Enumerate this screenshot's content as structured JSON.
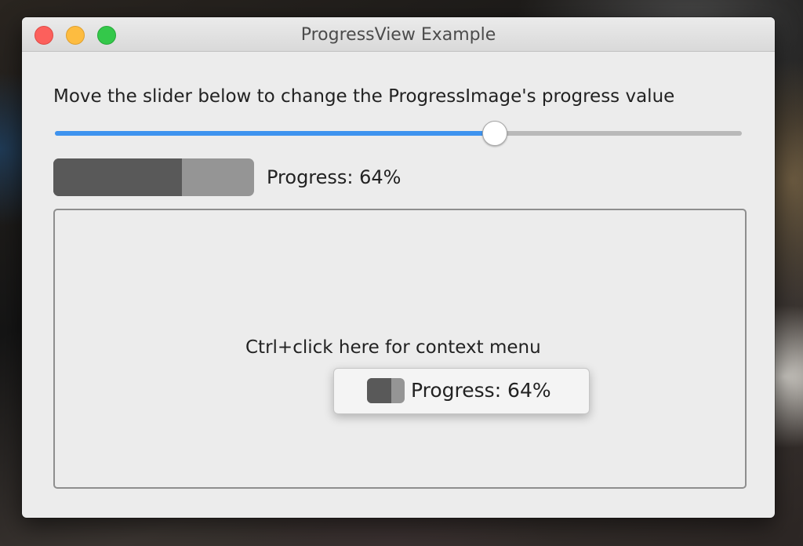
{
  "window": {
    "title": "ProgressView Example"
  },
  "main": {
    "instruction": "Move the slider below to change the ProgressImage's progress value",
    "slider": {
      "value": 0.64
    },
    "progress_image": {
      "value": 0.64
    },
    "progress_label": "Progress: 64%",
    "context_area": {
      "hint": "Ctrl+click here for context menu"
    }
  },
  "context_menu": {
    "item_label": "Progress: 64%",
    "icon": "progress-image-icon",
    "progress_value": 0.64
  },
  "colors": {
    "slider_fill": "#3e93ef",
    "progress_fill": "#595959",
    "progress_remaining": "#959595"
  }
}
